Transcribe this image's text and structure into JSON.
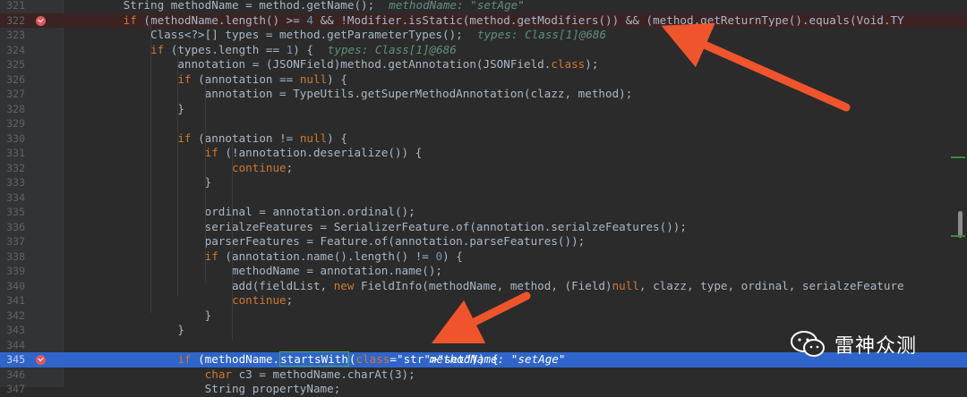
{
  "editor": {
    "lines": [
      {
        "num": "321",
        "code": "        String methodName = method.getName();",
        "hint": "methodName: \"setAge\""
      },
      {
        "num": "322",
        "code": "        if (methodName.length() >= 4 && !Modifier.isStatic(method.getModifiers()) && (method.getReturnType().equals(Void.TY",
        "hint": ""
      },
      {
        "num": "323",
        "code": "            Class<?>[] types = method.getParameterTypes();",
        "hint": "types: Class[1]@686"
      },
      {
        "num": "324",
        "code": "            if (types.length == 1) {",
        "hint": "types: Class[1]@686"
      },
      {
        "num": "325",
        "code": "                annotation = (JSONField)method.getAnnotation(JSONField.class);",
        "hint": ""
      },
      {
        "num": "326",
        "code": "                if (annotation == null) {",
        "hint": ""
      },
      {
        "num": "327",
        "code": "                    annotation = TypeUtils.getSuperMethodAnnotation(clazz, method);",
        "hint": ""
      },
      {
        "num": "328",
        "code": "                }",
        "hint": ""
      },
      {
        "num": "329",
        "code": "",
        "hint": ""
      },
      {
        "num": "330",
        "code": "                if (annotation != null) {",
        "hint": ""
      },
      {
        "num": "331",
        "code": "                    if (!annotation.deserialize()) {",
        "hint": ""
      },
      {
        "num": "332",
        "code": "                        continue;",
        "hint": ""
      },
      {
        "num": "333",
        "code": "                    }",
        "hint": ""
      },
      {
        "num": "334",
        "code": "",
        "hint": ""
      },
      {
        "num": "335",
        "code": "                    ordinal = annotation.ordinal();",
        "hint": ""
      },
      {
        "num": "336",
        "code": "                    serialzeFeatures = SerializerFeature.of(annotation.serialzeFeatures());",
        "hint": ""
      },
      {
        "num": "337",
        "code": "                    parserFeatures = Feature.of(annotation.parseFeatures());",
        "hint": ""
      },
      {
        "num": "338",
        "code": "                    if (annotation.name().length() != 0) {",
        "hint": ""
      },
      {
        "num": "339",
        "code": "                        methodName = annotation.name();",
        "hint": ""
      },
      {
        "num": "340",
        "code": "                        add(fieldList, new FieldInfo(methodName, method, (Field)null, clazz, type, ordinal, serialzeFeature",
        "hint": ""
      },
      {
        "num": "341",
        "code": "                        continue;",
        "hint": ""
      },
      {
        "num": "342",
        "code": "                    }",
        "hint": ""
      },
      {
        "num": "343",
        "code": "                }",
        "hint": ""
      },
      {
        "num": "344",
        "code": "",
        "hint": ""
      },
      {
        "num": "345",
        "code": "                if (methodName.startsWith(\"set\")) {",
        "hint": "methodName: \"setAge\""
      },
      {
        "num": "346",
        "code": "                    char c3 = methodName.charAt(3);",
        "hint": ""
      },
      {
        "num": "347",
        "code": "                    String propertyName;",
        "hint": ""
      }
    ]
  },
  "watermark": {
    "text": "雷神众测",
    "icon": "wechat-icon"
  },
  "colors": {
    "background": "#2b2b2b",
    "current_line": "#2f65ca",
    "breakpoint": "#db5c5c",
    "arrow": "#f0542c"
  }
}
